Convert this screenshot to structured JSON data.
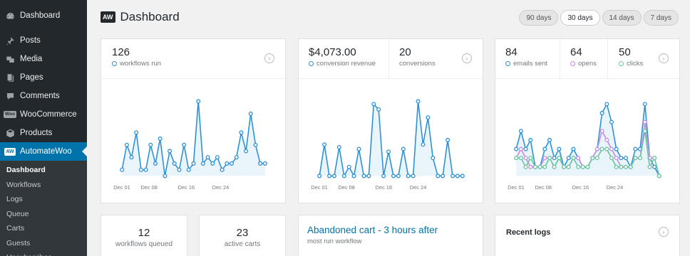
{
  "sidebar": {
    "items": [
      {
        "label": "Dashboard",
        "icon": "dashboard-icon"
      },
      {
        "label": "Posts",
        "icon": "pin-icon"
      },
      {
        "label": "Media",
        "icon": "media-icon"
      },
      {
        "label": "Pages",
        "icon": "pages-icon"
      },
      {
        "label": "Comments",
        "icon": "comment-icon"
      },
      {
        "label": "WooCommerce",
        "icon": "woocommerce-icon",
        "badge": "Woo"
      },
      {
        "label": "Products",
        "icon": "products-icon"
      },
      {
        "label": "AutomateWoo",
        "icon": "automatewoo-icon",
        "badge": "AW"
      }
    ],
    "submenu": [
      "Dashboard",
      "Workflows",
      "Logs",
      "Queue",
      "Carts",
      "Guests",
      "Unsubscribes"
    ]
  },
  "header": {
    "logo": "AW",
    "title": "Dashboard"
  },
  "ranges": [
    "90 days",
    "30 days",
    "14 days",
    "7 days"
  ],
  "active_range": "30 days",
  "cards": {
    "workflows": {
      "value": "126",
      "label": "workflows run"
    },
    "conversion_revenue": {
      "value": "$4,073.00",
      "label": "conversion revenue"
    },
    "conversions": {
      "value": "20",
      "label": "conversions"
    },
    "emails_sent": {
      "value": "84",
      "label": "emails sent"
    },
    "opens": {
      "value": "64",
      "label": "opens"
    },
    "clicks": {
      "value": "50",
      "label": "clicks"
    },
    "queued": {
      "value": "12",
      "label": "workflows queued"
    },
    "active_carts": {
      "value": "23",
      "label": "active carts"
    },
    "most_run": {
      "title": "Abandoned cart - 3 hours after",
      "subtitle": "most run workflow"
    },
    "recent_logs": {
      "title": "Recent logs"
    }
  },
  "colors": {
    "blue": "#2d91d6",
    "purple": "#c98ae8",
    "green": "#68c69b",
    "accent": "#0073aa"
  },
  "chart_data": [
    {
      "type": "line",
      "x_ticks": [
        "Dec 01",
        "Dec 08",
        "Dec 16",
        "Dec 24"
      ],
      "series": [
        {
          "name": "workflows run",
          "color": "#2d91d6",
          "values": [
            1,
            5,
            3,
            7,
            1,
            1,
            5,
            2,
            6,
            0,
            4,
            2,
            1,
            5,
            1,
            2,
            12,
            2,
            3,
            2,
            3,
            1,
            2,
            2,
            3,
            7,
            4,
            10,
            5,
            2,
            2
          ]
        }
      ],
      "ylim": [
        0,
        13
      ]
    },
    {
      "type": "line",
      "x_ticks": [
        "Dec 01",
        "Dec 08",
        "Dec 16",
        "Dec 24"
      ],
      "series": [
        {
          "name": "conversion revenue",
          "color": "#2d91d6",
          "values": [
            0,
            350,
            0,
            0,
            320,
            0,
            100,
            0,
            300,
            0,
            0,
            800,
            740,
            0,
            270,
            0,
            0,
            300,
            0,
            0,
            830,
            350,
            650,
            200,
            0,
            0,
            400,
            0,
            0,
            0
          ]
        }
      ],
      "ylim": [
        0,
        900
      ]
    },
    {
      "type": "line",
      "x_ticks": [
        "Dec 01",
        "Dec 08",
        "Dec 16",
        "Dec 24"
      ],
      "series": [
        {
          "name": "emails sent",
          "color": "#2d91d6",
          "values": [
            3,
            5,
            3,
            4,
            1,
            1,
            3,
            4,
            2,
            3,
            1,
            2,
            3,
            2,
            1,
            1,
            2,
            3,
            7,
            8,
            6,
            3,
            2,
            2,
            1,
            3,
            3,
            8,
            2,
            1,
            0
          ]
        },
        {
          "name": "opens",
          "color": "#c98ae8",
          "values": [
            2,
            3,
            2,
            1,
            1,
            1,
            2,
            2,
            1,
            2,
            1,
            1,
            2,
            2,
            1,
            1,
            2,
            3,
            5,
            4,
            3,
            2,
            1,
            1,
            1,
            2,
            2,
            6,
            2,
            2,
            0
          ]
        },
        {
          "name": "clicks",
          "color": "#68c69b",
          "values": [
            2,
            2,
            1,
            2,
            1,
            1,
            1,
            2,
            1,
            2,
            1,
            1,
            2,
            1,
            1,
            1,
            2,
            2,
            3,
            3,
            2,
            1,
            1,
            1,
            1,
            2,
            2,
            5,
            1,
            2,
            0
          ]
        }
      ],
      "ylim": [
        0,
        9
      ]
    }
  ]
}
